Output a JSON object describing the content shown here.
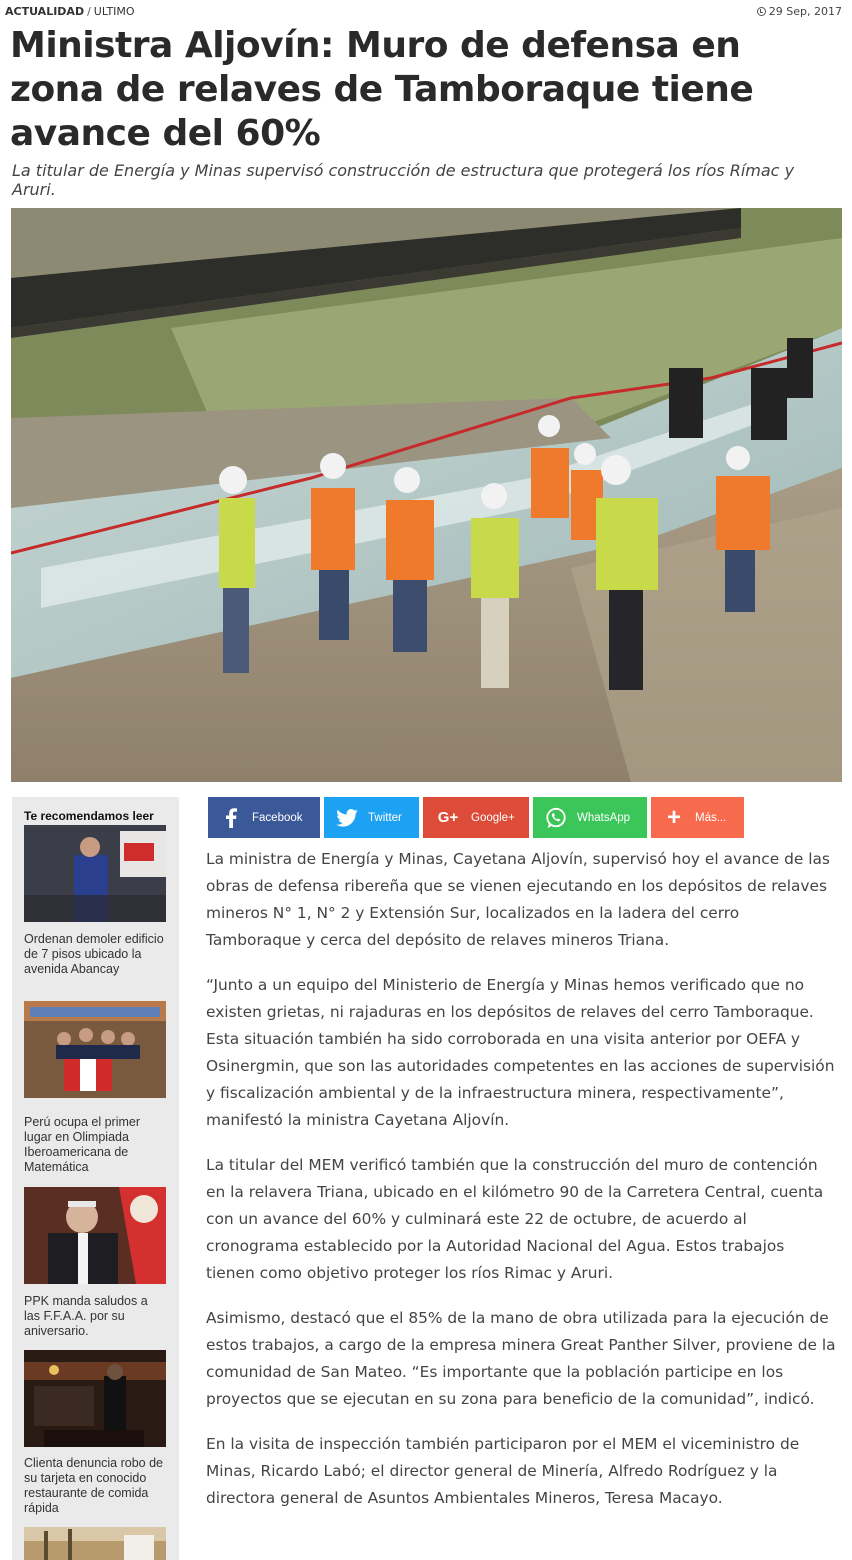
{
  "breadcrumb": {
    "section": "ACTUALIDAD",
    "separator": "/",
    "subsection": "ULTIMO"
  },
  "date": "29 Sep, 2017",
  "headline": "Ministra Aljovín: Muro de defensa en zona de relaves de Tamboraque tiene avance del 60%",
  "subtitle": "La titular de Energía y Minas supervisó construcción de estructura que protegerá los ríos Rímac y Aruri.",
  "sidebar": {
    "heading": "Te recomendamos leer",
    "items": [
      {
        "caption": "Ordenan demoler edificio de 7 pisos ubicado la avenida Abancay"
      },
      {
        "caption": "Perú ocupa el primer lugar en Olimpiada Iberoamericana de Matemática"
      },
      {
        "caption": "PPK manda saludos a las F.F.A.A. por su aniversario."
      },
      {
        "caption": "Clienta denuncia robo de su tarjeta en conocido restaurante de comida rápida"
      }
    ]
  },
  "share": [
    {
      "label": "Facebook",
      "icon": "facebook-icon",
      "color": "#3b5998"
    },
    {
      "label": "Twitter",
      "icon": "twitter-icon",
      "color": "#1da1f2"
    },
    {
      "label": "Google+",
      "icon": "google-plus-icon",
      "color": "#dd4b39"
    },
    {
      "label": "WhatsApp",
      "icon": "whatsapp-icon",
      "color": "#3cc659"
    },
    {
      "label": "Más...",
      "icon": "plus-icon",
      "color": "#f76a4e"
    }
  ],
  "article": {
    "paragraphs": [
      "La ministra de Energía y Minas, Cayetana Aljovín, supervisó hoy el avance de las obras de defensa ribereña que se vienen ejecutando en los depósitos de relaves mineros  N° 1, N° 2 y Extensión Sur, localizados en la ladera del cerro Tamboraque y  cerca del depósito de relaves mineros Triana.",
      "“Junto a un equipo del Ministerio de Energía y Minas hemos verificado que no existen grietas, ni rajaduras en los depósitos de relaves del cerro Tamboraque. Esta situación también ha sido corroborada en una visita anterior por OEFA y Osinergmin, que son las autoridades competentes en las acciones de supervisión y fiscalización ambiental y de la infraestructura minera, respectivamente”, manifestó la ministra Cayetana Aljovín.",
      "La titular del MEM verificó también que la construcción del muro de contención en la relavera Triana, ubicado en el kilómetro 90 de la Carretera Central, cuenta con un avance del 60% y culminará este 22 de octubre, de acuerdo al cronograma establecido por la Autoridad Nacional del Agua. Estos trabajos tienen como objetivo proteger los ríos Rimac y Aruri.",
      "Asimismo, destacó que el 85% de la mano de obra utilizada para la ejecución de estos trabajos, a cargo de la empresa minera Great Panther Silver, proviene de la comunidad de San Mateo. “Es importante que la población participe en los proyectos que se ejecutan en su zona para beneficio de la comunidad”, indicó.",
      "En la visita de inspección también participaron por el MEM el viceministro de Minas, Ricardo Labó; el director general de Minería, Alfredo Rodríguez y la directora general de Asuntos Ambientales Mineros, Teresa Macayo."
    ]
  }
}
